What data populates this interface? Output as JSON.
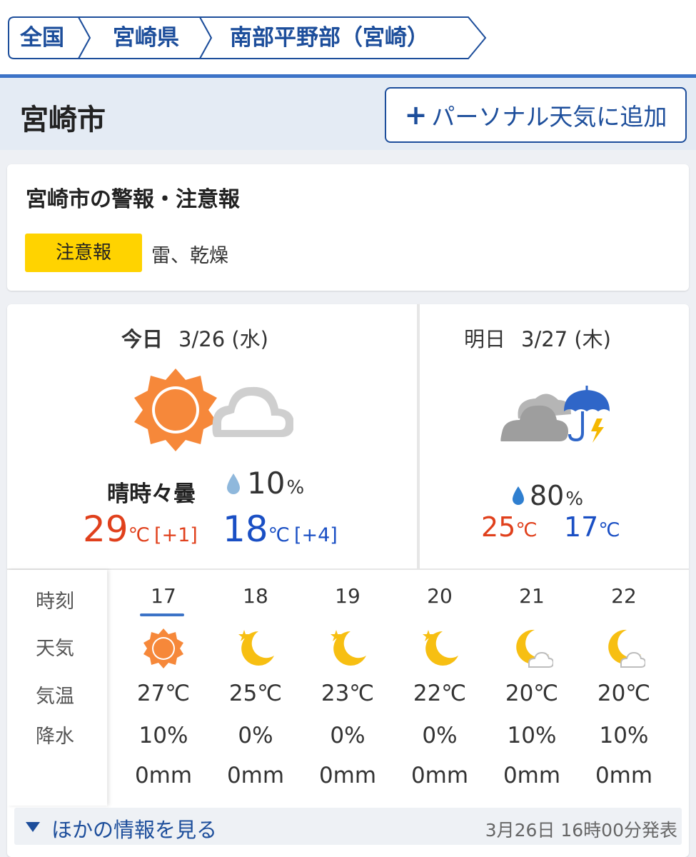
{
  "breadcrumb": [
    "全国",
    "宮崎県",
    "南部平野部（宮崎）"
  ],
  "city": "宮崎市",
  "add_button": {
    "plus": "+",
    "label": "パーソナル天気に追加"
  },
  "alert": {
    "title": "宮崎市の警報・注意報",
    "badge": "注意報",
    "text": "雷、乾燥"
  },
  "today": {
    "day": "今日",
    "date": "3/26 (水)",
    "weather_label": "晴時々曇",
    "weather_icons": [
      "sun-icon",
      "cloud-icon"
    ],
    "precip": "10",
    "precip_unit": "%",
    "high": "29",
    "high_diff": "[+1]",
    "low": "18",
    "low_diff": "[+4]",
    "temp_unit": "℃"
  },
  "tomorrow": {
    "day": "明日",
    "date": "3/27 (木)",
    "weather_icons": [
      "cloud-icon",
      "umbrella-lightning-icon"
    ],
    "precip": "80",
    "precip_unit": "%",
    "high": "25",
    "low": "17",
    "temp_unit": "℃"
  },
  "hourly": {
    "labels": [
      "時刻",
      "天気",
      "気温",
      "降水"
    ],
    "hours": [
      {
        "time": "17",
        "icon": "sun-icon",
        "temp": "27℃",
        "rain": "10%",
        "mm": "0mm"
      },
      {
        "time": "18",
        "icon": "moon-icon",
        "temp": "25℃",
        "rain": "0%",
        "mm": "0mm"
      },
      {
        "time": "19",
        "icon": "moon-icon",
        "temp": "23℃",
        "rain": "0%",
        "mm": "0mm"
      },
      {
        "time": "20",
        "icon": "moon-icon",
        "temp": "22℃",
        "rain": "0%",
        "mm": "0mm"
      },
      {
        "time": "21",
        "icon": "moon-cloud-icon",
        "temp": "20℃",
        "rain": "10%",
        "mm": "0mm"
      },
      {
        "time": "22",
        "icon": "moon-cloud-icon",
        "temp": "20℃",
        "rain": "10%",
        "mm": "0mm"
      }
    ]
  },
  "footer": {
    "more": "ほかの情報を見る",
    "issued": "3月26日 16時00分発表"
  },
  "colors": {
    "brand": "#1d4e9b",
    "accent": "#3c73c7",
    "high": "#e0401c",
    "low": "#1a4fc4",
    "badge": "#ffd300",
    "sun": "#f6883a"
  }
}
